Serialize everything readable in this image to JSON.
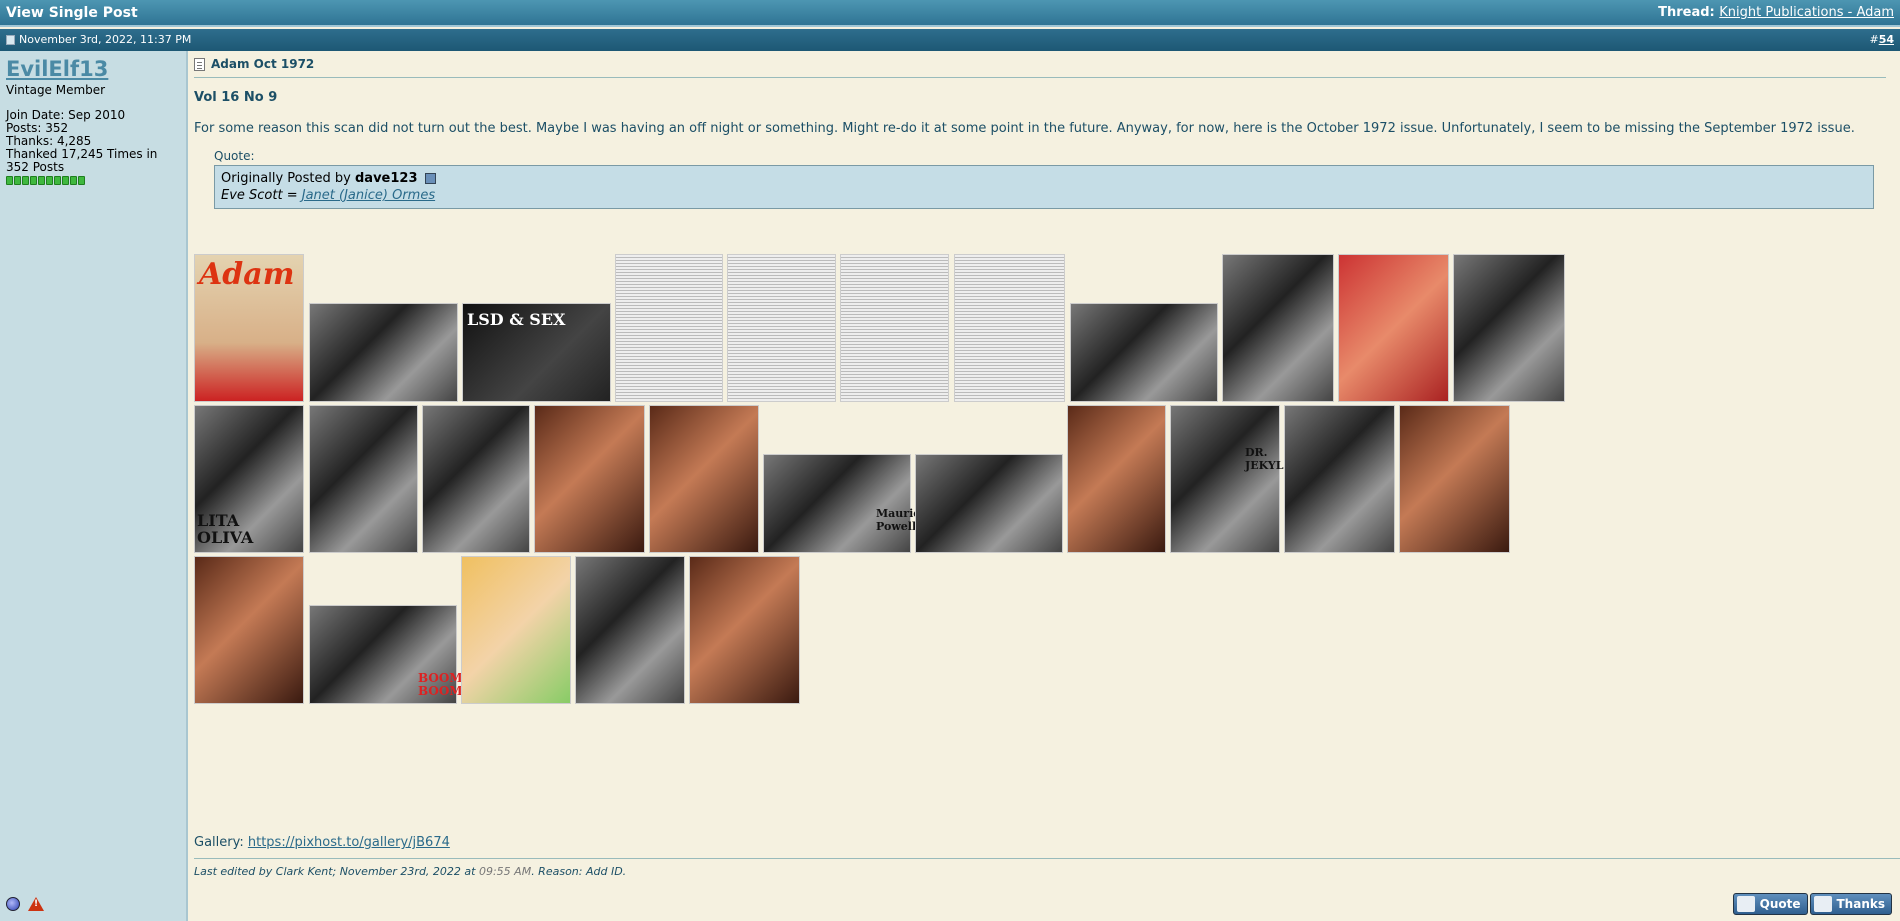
{
  "title_bar": {
    "title": "View Single Post",
    "thread_label": "Thread:",
    "thread_link": "Knight Publications - Adam"
  },
  "date_bar": {
    "date": "November 3rd, 2022, 11:37 PM",
    "post_number_prefix": "#",
    "post_number": "54"
  },
  "user": {
    "username": "EvilElf13",
    "rank": "Vintage Member",
    "join_date": "Join Date: Sep 2010",
    "posts": "Posts: 352",
    "thanks": "Thanks: 4,285",
    "thanked": "Thanked 17,245 Times in 352 Posts"
  },
  "post": {
    "title": "Adam Oct 1972",
    "volume": "Vol 16 No 9",
    "body": "For some reason this scan did not turn out the best. Maybe I was having an off night or something. Might re-do it at some point in the future. Anyway, for now, here is the October 1972 issue. Unfortunately, I seem to be missing the September 1972 issue.",
    "quote": {
      "label": "Quote:",
      "originally_posted_by": "Originally Posted by",
      "author": "dave123",
      "text_prefix": "Eve Scott = ",
      "text_link": "Janet (Janice) Ormes"
    },
    "thumb_labels": {
      "cover_title": "Adam",
      "lsd": "LSD & SEX",
      "lita": "LITA OLIVA",
      "maurica": "Maurica Powell",
      "jekyl": "DR. JEKYL",
      "boom": "BOOM BOOM"
    },
    "gallery_label": "Gallery:",
    "gallery_link": "https://pixhost.to/gallery/jB674",
    "edit": {
      "prefix": "Last edited by Clark Kent; November 23rd, 2022 at",
      "time": "09:55 AM",
      "reason": ". Reason: Add ID."
    }
  },
  "buttons": {
    "quote": "Quote",
    "thanks": "Thanks"
  }
}
